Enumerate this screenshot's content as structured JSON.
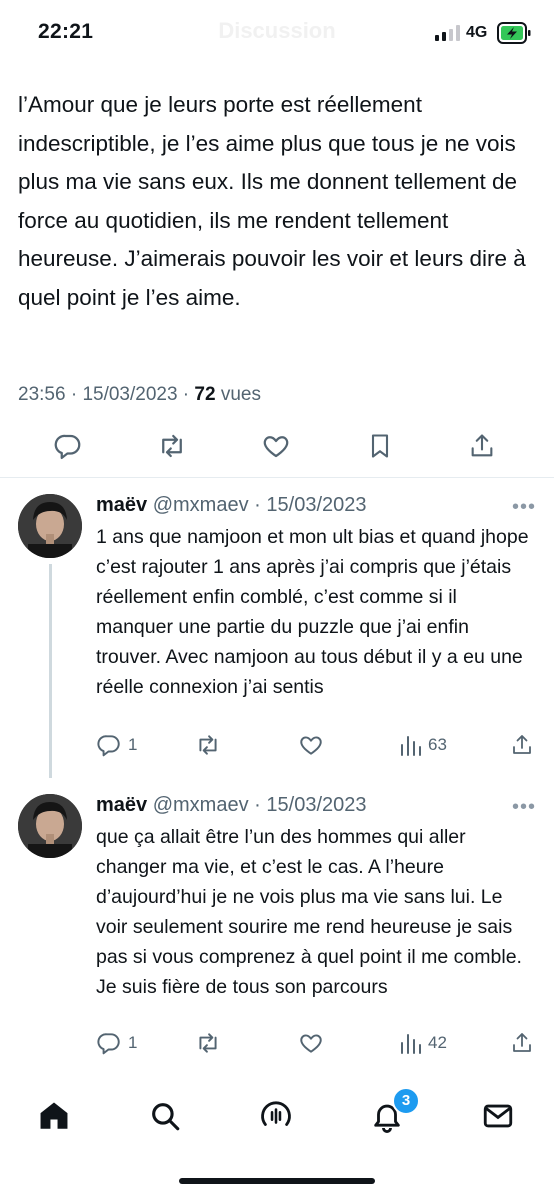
{
  "status_bar": {
    "time": "22:21",
    "header_title": "Discussion",
    "network": "4G"
  },
  "tweet": {
    "text": "l’Amour que je leurs porte est réellement indescriptible, je l’es aime plus que tous je ne vois plus ma vie sans eux. Ils me donnent tellement de force au quotidien, ils me rendent tellement heureuse. J’aimerais pouvoir les voir et leurs dire à quel point je l’es aime.",
    "time": "23:56",
    "sep1": " · ",
    "date": "15/03/2023",
    "sep2": " · ",
    "views_count": "72",
    "views_label": " vues",
    "actions": [
      "reply-icon",
      "retweet-icon",
      "like-icon",
      "bookmark-icon",
      "share-icon"
    ]
  },
  "replies": [
    {
      "name": "maëv",
      "handle": "@mxmaev",
      "dot": "·",
      "date": "15/03/2023",
      "more": "•••",
      "text": "1 ans que namjoon et mon ult bias et quand jhope c’est rajouter 1 ans après j’ai compris que j’étais réellement enfin comblé, c’est comme si il manquer une partie du puzzle que j’ai enfin trouver. Avec namjoon au tous début il y a eu une réelle connexion j’ai sentis",
      "reply_count": "1",
      "views_count": "63"
    },
    {
      "name": "maëv",
      "handle": "@mxmaev",
      "dot": "·",
      "date": "15/03/2023",
      "more": "•••",
      "text": "que ça allait être l’un des hommes qui aller changer ma vie, et c’est le cas. A l’heure d’aujourd’hui je ne vois plus ma vie sans lui. Le voir seulement sourire me rend heureuse je sais pas si vous comprenez à quel point il me comble. Je suis fière de tous son parcours",
      "reply_count": "1",
      "views_count": "42"
    }
  ],
  "tabbar": {
    "items": [
      "home-icon",
      "search-icon",
      "spaces-icon",
      "notifications-icon",
      "messages-icon"
    ],
    "notification_badge": "3"
  },
  "colors": {
    "text": "#0f1419",
    "secondary": "#536471",
    "accent": "#1d9bf0",
    "battery": "#34c759"
  }
}
